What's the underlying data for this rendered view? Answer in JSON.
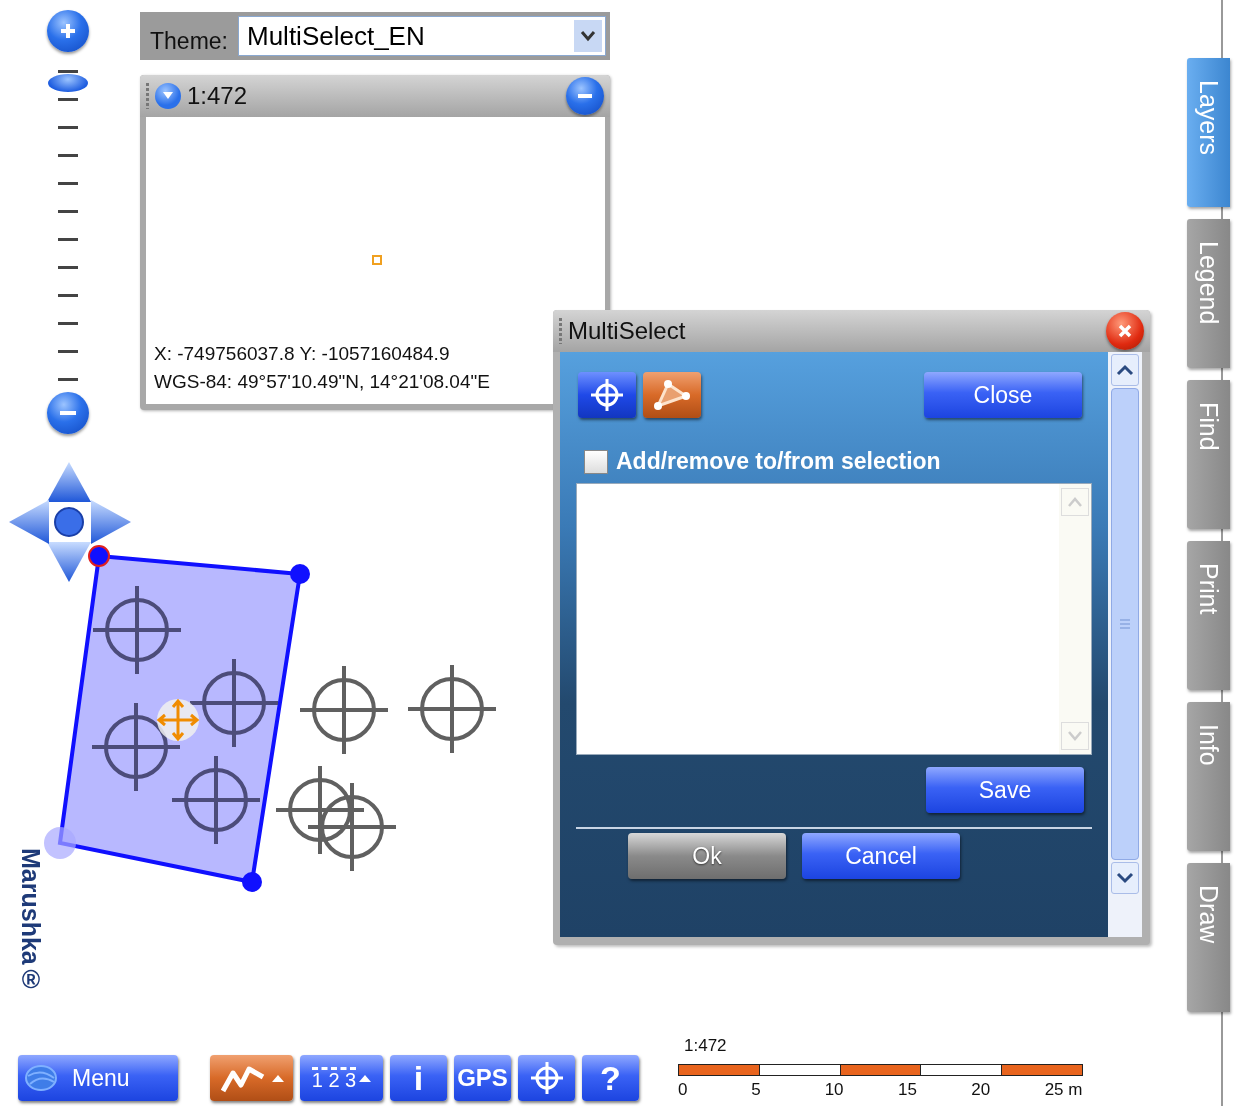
{
  "zoom_slider": {
    "level": 0.95
  },
  "theme": {
    "label": "Theme:",
    "value": "MultiSelect_EN"
  },
  "overview": {
    "scale": "1:472",
    "coordinates": [
      "X: -749756037.8 Y: -1057160484.9",
      "WGS-84: 49°57'10.49\"N, 14°21'08.04\"E"
    ]
  },
  "map": {
    "logo": "Marushka®"
  },
  "multiselect": {
    "title": "MultiSelect",
    "tools": [
      {
        "kind": "point",
        "selected": false
      },
      {
        "kind": "polygon",
        "selected": true
      }
    ],
    "close_label": "Close",
    "checkbox": {
      "label": "Add/remove to/from selection",
      "checked": false
    },
    "save_label": "Save",
    "buttons": [
      {
        "label": "Ok",
        "disabled": true
      },
      {
        "label": "Cancel",
        "disabled": false
      }
    ]
  },
  "side_tabs": [
    {
      "label": "Layers",
      "selected": true
    },
    {
      "label": "Legend",
      "selected": false
    },
    {
      "label": "Find",
      "selected": false
    },
    {
      "label": "Print",
      "selected": false
    },
    {
      "label": "Info",
      "selected": false
    },
    {
      "label": "Draw",
      "selected": false
    }
  ],
  "toolbar": {
    "menu_label": "Menu",
    "tools": [
      {
        "kind": "measure",
        "selected": true,
        "has_menu": true
      },
      {
        "kind": "numbering",
        "label": "1 2 3",
        "selected": false,
        "has_menu": true
      },
      {
        "kind": "info",
        "label": "i",
        "selected": false,
        "has_menu": false
      },
      {
        "kind": "gps",
        "label": "GPS",
        "selected": false,
        "has_menu": false
      },
      {
        "kind": "locate",
        "selected": false,
        "has_menu": false
      },
      {
        "kind": "help",
        "label": "?",
        "selected": false,
        "has_menu": false
      }
    ]
  },
  "scale_bar": {
    "scale": "1:472",
    "ticks": [
      "0",
      "5",
      "10",
      "15",
      "20",
      "25 m"
    ]
  }
}
